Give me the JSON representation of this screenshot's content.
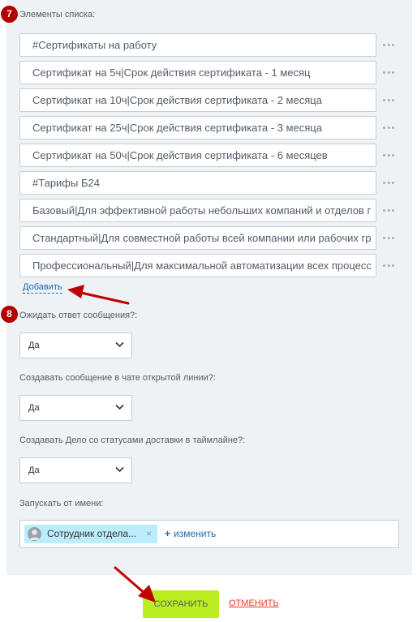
{
  "list_section": {
    "badge": "7",
    "label": "Элементы списка:",
    "items": [
      "#Сертификаты на работу",
      "Сертификат на 5ч|Срок действия сертификата - 1 месяц",
      "Сертификат на 10ч|Срок действия сертификата - 2 месяца",
      "Сертификат на 25ч|Срок действия сертификата - 3 месяца",
      "Сертификат на 50ч|Срок действия сертификата - 6 месяцев",
      "#Тарифы Б24",
      "Базовый|Для эффективной работы небольших компаний и отделов пр",
      "Стандартный|Для совместной работы всей компании или рабочих гру",
      "Профессиональный|Для максимальной автоматизации всех процессов"
    ],
    "add_label": "Добавить"
  },
  "wait_reply": {
    "badge": "8",
    "label": "Ожидать ответ сообщения?:",
    "value": "Да"
  },
  "create_message": {
    "label": "Создавать сообщение в чате открытой линии?:",
    "value": "Да"
  },
  "create_task": {
    "label": "Создавать Дело со статусами доставки в таймлайне?:",
    "value": "Да"
  },
  "run_as": {
    "label": "Запускать от имени:",
    "user_name": "Сотрудник отдела...",
    "remove_symbol": "×",
    "change_plus": "+",
    "change_label": "изменить"
  },
  "actions": {
    "save_label": "СОХРАНИТЬ",
    "cancel_label": "ОТМЕНИТЬ"
  },
  "colors": {
    "badge": "#b30000",
    "arrow": "#c00000",
    "save_button": "#bbed21",
    "cancel_link": "#f0371b",
    "link": "#2067b0",
    "panel_bg": "#eef2f4",
    "user_chip": "#bcedfc"
  },
  "icons": {
    "row_menu": "three-dots-icon",
    "select_arrow": "chevron-down-icon",
    "user_avatar": "user-avatar-icon",
    "chip_remove": "close-icon"
  }
}
